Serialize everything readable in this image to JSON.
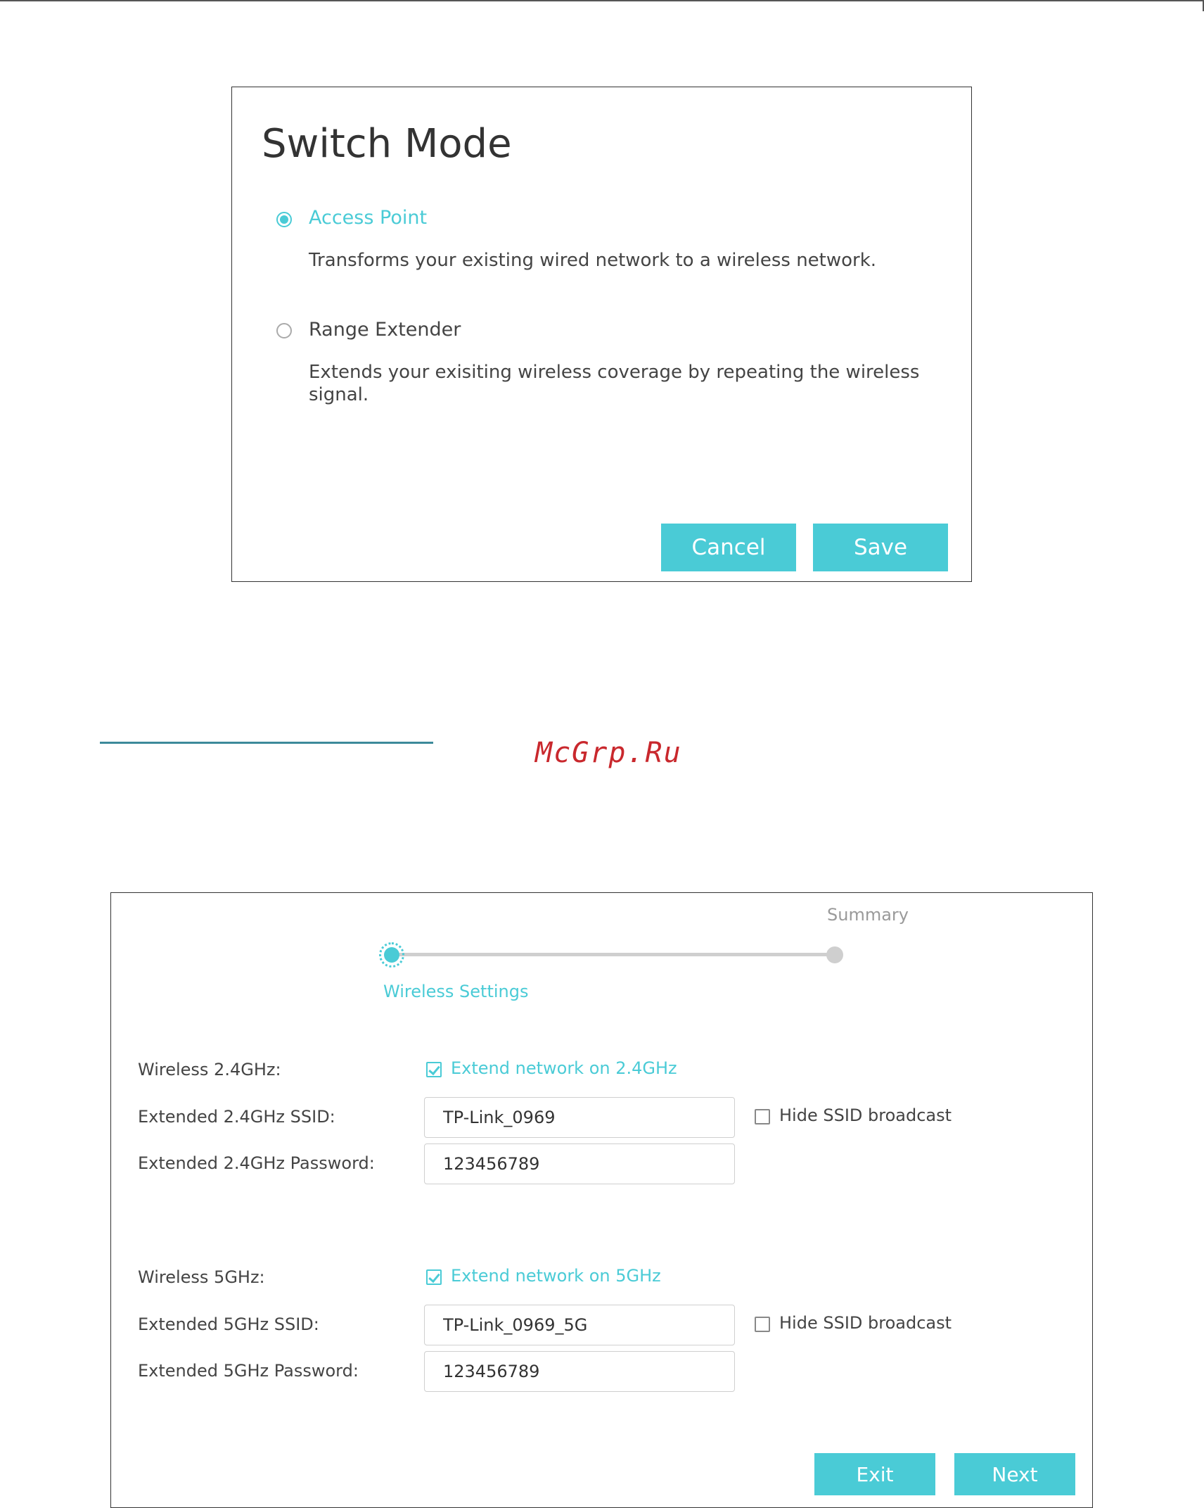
{
  "switch_mode": {
    "title": "Switch Mode",
    "options": [
      {
        "label": "Access Point",
        "description": "Transforms your existing wired network to a wireless network.",
        "selected": true
      },
      {
        "label": "Range Extender",
        "description": "Extends your exisiting wireless coverage by repeating the wireless signal.",
        "selected": false
      }
    ],
    "cancel_label": "Cancel",
    "save_label": "Save"
  },
  "watermark": "McGrp.Ru",
  "wizard": {
    "steps": [
      {
        "label": "Wireless Settings",
        "active": true
      },
      {
        "label": "Summary",
        "active": false
      }
    ],
    "band_24": {
      "wireless_label": "Wireless 2.4GHz:",
      "extend_label": "Extend network on 2.4GHz",
      "extend_checked": true,
      "ssid_label": "Extended 2.4GHz SSID:",
      "ssid_value": "TP-Link_0969",
      "hide_label": "Hide SSID broadcast",
      "hide_checked": false,
      "password_label": "Extended 2.4GHz Password:",
      "password_value": "123456789"
    },
    "band_5": {
      "wireless_label": "Wireless 5GHz:",
      "extend_label": "Extend network on 5GHz",
      "extend_checked": true,
      "ssid_label": "Extended 5GHz SSID:",
      "ssid_value": "TP-Link_0969_5G",
      "hide_label": "Hide SSID broadcast",
      "hide_checked": false,
      "password_label": "Extended 5GHz Password:",
      "password_value": "123456789"
    },
    "exit_label": "Exit",
    "next_label": "Next"
  },
  "colors": {
    "accent": "#4acbd6",
    "watermark": "#c9282d",
    "divider": "#3c8a9a"
  }
}
